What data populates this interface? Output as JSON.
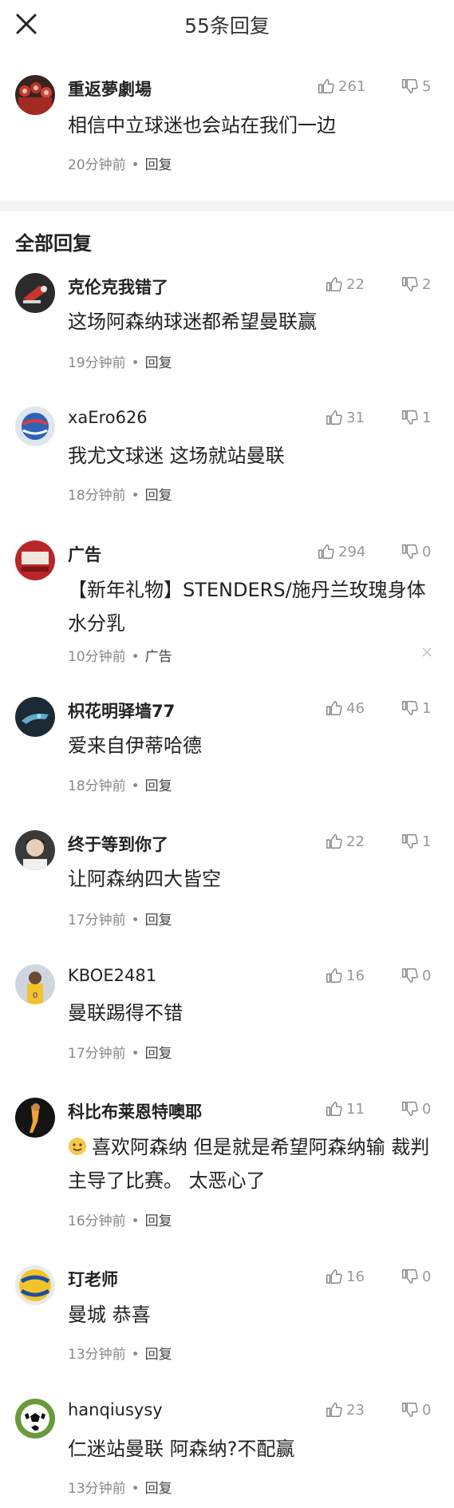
{
  "header": {
    "title": "55条回复"
  },
  "pinned": {
    "username": "重返夢劇場",
    "likes": "261",
    "dislikes": "5",
    "text": "相信中立球迷也会站在我们一边",
    "time": "20分钟前",
    "reply_label": "回复"
  },
  "section": {
    "title": "全部回复"
  },
  "comments": [
    {
      "username": "克伦克我错了",
      "likes": "22",
      "dislikes": "2",
      "text": "这场阿森纳球迷都希望曼联赢",
      "time": "19分钟前",
      "reply_label": "回复"
    },
    {
      "username": "xaEro626",
      "likes": "31",
      "dislikes": "1",
      "text": "我尤文球迷 这场就站曼联",
      "time": "18分钟前",
      "reply_label": "回复"
    },
    {
      "username": "广告",
      "likes": "294",
      "dislikes": "0",
      "text": "【新年礼物】STENDERS/施丹兰玫瑰身体水分乳",
      "time": "10分钟前",
      "reply_label": "广告"
    },
    {
      "username": "枳花明驿墙77",
      "likes": "46",
      "dislikes": "1",
      "text": "爱来自伊蒂哈德",
      "time": "18分钟前",
      "reply_label": "回复"
    },
    {
      "username": "终于等到你了",
      "likes": "22",
      "dislikes": "1",
      "text": "让阿森纳四大皆空",
      "time": "17分钟前",
      "reply_label": "回复"
    },
    {
      "username": "KBOE2481",
      "likes": "16",
      "dislikes": "0",
      "text": "曼联踢得不错",
      "time": "17分钟前",
      "reply_label": "回复"
    },
    {
      "username": "科比布莱恩特噢耶",
      "likes": "11",
      "dislikes": "0",
      "text": "喜欢阿森纳 但是就是希望阿森纳输 裁判主导了比赛。 太恶心了",
      "time": "16分钟前",
      "reply_label": "回复"
    },
    {
      "username": "玎老师",
      "likes": "16",
      "dislikes": "0",
      "text": "曼城 恭喜",
      "time": "13分钟前",
      "reply_label": "回复"
    },
    {
      "username": "hanqiusysy",
      "likes": "23",
      "dislikes": "0",
      "text": "仁迷站曼联 阿森纳?不配赢",
      "time": "13分钟前",
      "reply_label": "回复"
    }
  ],
  "ad_tags": {
    "close_symbol": "×"
  },
  "icons": {
    "like": "thumbs-up-icon",
    "dislike": "thumbs-down-icon",
    "close": "close-icon"
  },
  "colors": {
    "text": "#222222",
    "muted": "#999999",
    "divider": "#f3f4f6"
  }
}
